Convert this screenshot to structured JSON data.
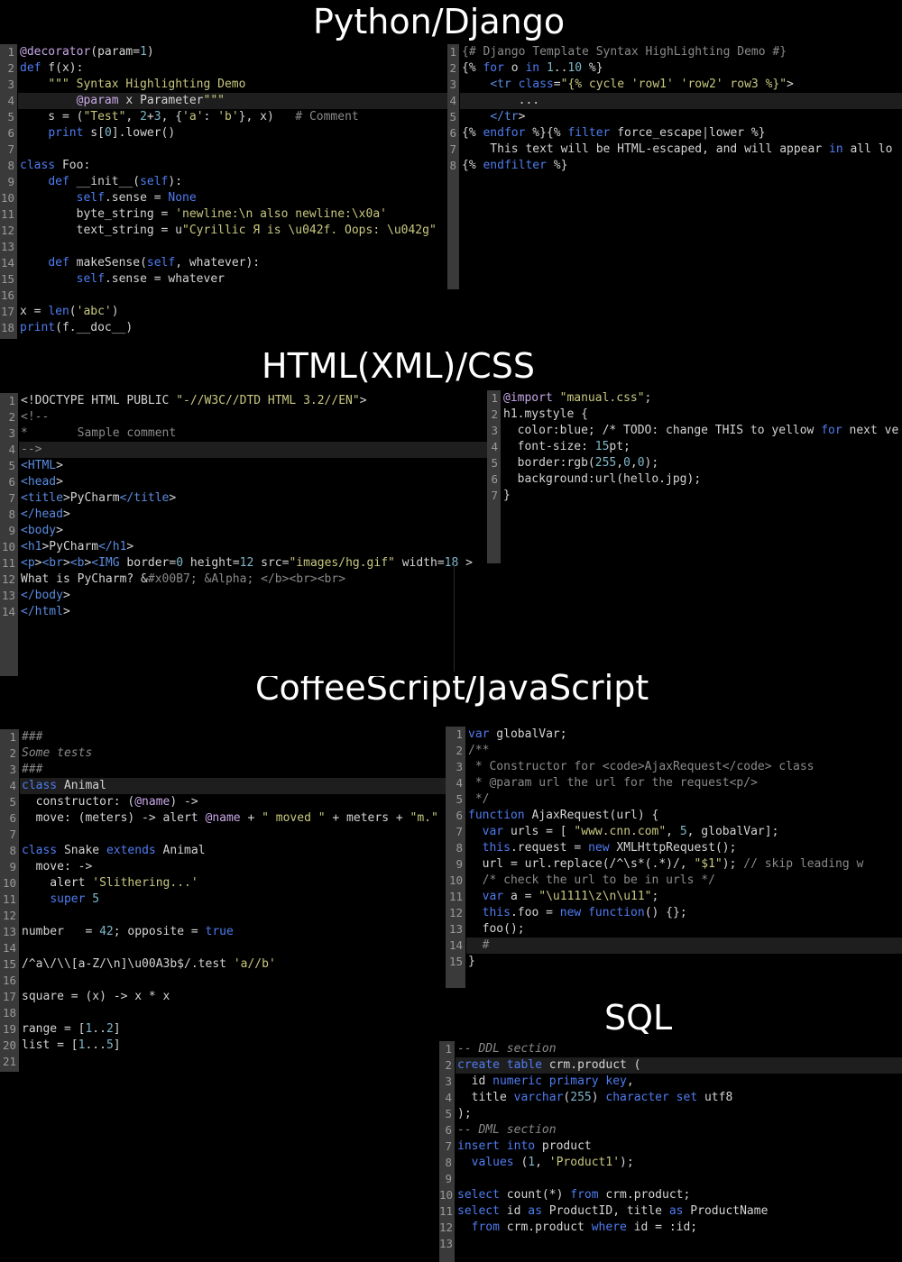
{
  "titles": {
    "python": "Python/Django",
    "html": "HTML(XML)/CSS",
    "coffee": "CoffeeScript/JavaScript",
    "sql": "SQL"
  },
  "python_lines": [
    "@decorator(param=1)",
    "def f(x):",
    "    \"\"\" Syntax Highlighting Demo",
    "        @param x Parameter\"\"\"",
    "    s = (\"Test\", 2+3, {'a': 'b'}, x)   # Comment",
    "    print s[0].lower()",
    "",
    "class Foo:",
    "    def __init__(self):",
    "        self.sense = None",
    "        byte_string = 'newline:\\n also newline:\\x0a'",
    "        text_string = u\"Cyrillic Я is \\u042f. Oops: \\u042g\"",
    "",
    "    def makeSense(self, whatever):",
    "        self.sense = whatever",
    "",
    "x = len('abc')",
    "print(f.__doc__)"
  ],
  "django_lines": [
    "{# Django Template Syntax HighLighting Demo #}",
    "{% for o in 1..10 %}",
    "    <tr class=\"{% cycle 'row1' 'row2' row3 %}\">",
    "        ...",
    "    </tr>",
    "{% endfor %}{% filter force_escape|lower %}",
    "    This text will be HTML-escaped, and will appear in all lo",
    "{% endfilter %}"
  ],
  "html_lines": [
    "<!DOCTYPE HTML PUBLIC \"-//W3C//DTD HTML 3.2//EN\">",
    "<!--",
    "*       Sample comment",
    "-->",
    "<HTML>",
    "<head>",
    "<title>PyCharm</title>",
    "</head>",
    "<body>",
    "<h1>PyCharm</h1>",
    "<p><br><b><IMG border=0 height=12 src=\"images/hg.gif\" width=18 >",
    "What is PyCharm? &#x00B7; &Alpha; </b><br><br>",
    "</body>",
    "</html>"
  ],
  "css_lines": [
    "@import \"manual.css\";",
    "h1.mystyle {",
    "  color:blue; /* TODO: change THIS to yellow for next ve",
    "  font-size: 15pt;",
    "  border:rgb(255,0,0);",
    "  background:url(hello.jpg);",
    "}"
  ],
  "coffee_lines": [
    "###",
    "Some tests",
    "###",
    "class Animal",
    "  constructor: (@name) ->",
    "  move: (meters) -> alert @name + \" moved \" + meters + \"m.\"",
    "",
    "class Snake extends Animal",
    "  move: ->",
    "    alert 'Slithering...'",
    "    super 5",
    "",
    "number   = 42; opposite = true",
    "",
    "/^a\\/\\\\[a-Z/\\n]\\u00A3b$/.test 'a//b'",
    "",
    "square = (x) -> x * x",
    "",
    "range = [1..2]",
    "list = [1...5]",
    ""
  ],
  "js_lines": [
    "var globalVar;",
    "/**",
    " * Constructor for <code>AjaxRequest</code> class",
    " * @param url the url for the request<p/>",
    " */",
    "function AjaxRequest(url) {",
    "  var urls = [ \"www.cnn.com\", 5, globalVar];",
    "  this.request = new XMLHttpRequest();",
    "  url = url.replace(/^\\s*(.*)/, \"$1\"); // skip leading w",
    "  /* check the url to be in urls */",
    "  var a = \"\\u1111\\z\\n\\u11\";",
    "  this.foo = new function() {};",
    "  foo();",
    "  #",
    "}"
  ],
  "sql_lines": [
    "-- DDL section",
    "create table crm.product (",
    "  id numeric primary key,",
    "  title varchar(255) character set utf8",
    ");",
    "-- DML section",
    "insert into product",
    "  values (1, 'Product1');",
    "",
    "select count(*) from crm.product;",
    "select id as ProductID, title as ProductName",
    "  from crm.product where id = :id;",
    ""
  ]
}
